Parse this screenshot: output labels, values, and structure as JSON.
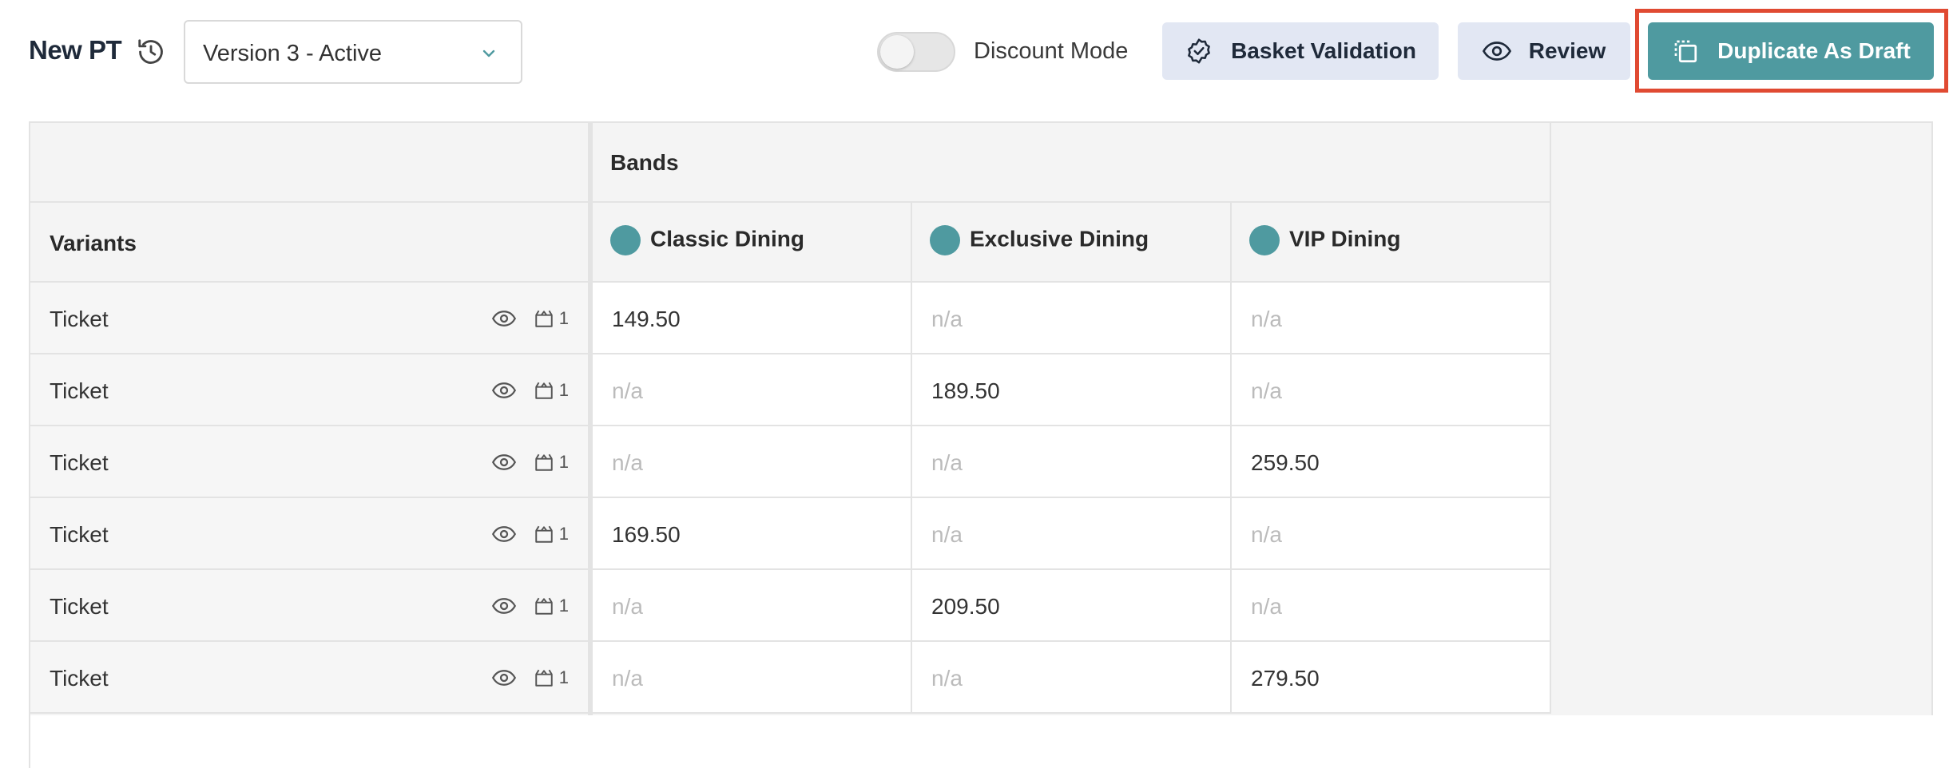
{
  "header": {
    "title": "New PT",
    "version": "Version 3 - Active",
    "discount_mode_label": "Discount Mode",
    "discount_mode_on": false,
    "buttons": {
      "basket_validation": "Basket Validation",
      "review": "Review",
      "duplicate": "Duplicate As Draft"
    },
    "colors": {
      "accent": "#4f9aa0",
      "light_button": "#e2e7f3",
      "highlight": "#e04a32"
    }
  },
  "table": {
    "group_header": "Bands",
    "variants_header": "Variants",
    "bands": [
      "Classic Dining",
      "Exclusive Dining",
      "VIP Dining"
    ],
    "rows": [
      {
        "variant": "Ticket",
        "count": "1",
        "prices": [
          "149.50",
          "n/a",
          "n/a"
        ]
      },
      {
        "variant": "Ticket",
        "count": "1",
        "prices": [
          "n/a",
          "189.50",
          "n/a"
        ]
      },
      {
        "variant": "Ticket",
        "count": "1",
        "prices": [
          "n/a",
          "n/a",
          "259.50"
        ]
      },
      {
        "variant": "Ticket",
        "count": "1",
        "prices": [
          "169.50",
          "n/a",
          "n/a"
        ]
      },
      {
        "variant": "Ticket",
        "count": "1",
        "prices": [
          "n/a",
          "209.50",
          "n/a"
        ]
      },
      {
        "variant": "Ticket",
        "count": "1",
        "prices": [
          "n/a",
          "n/a",
          "279.50"
        ]
      }
    ]
  }
}
